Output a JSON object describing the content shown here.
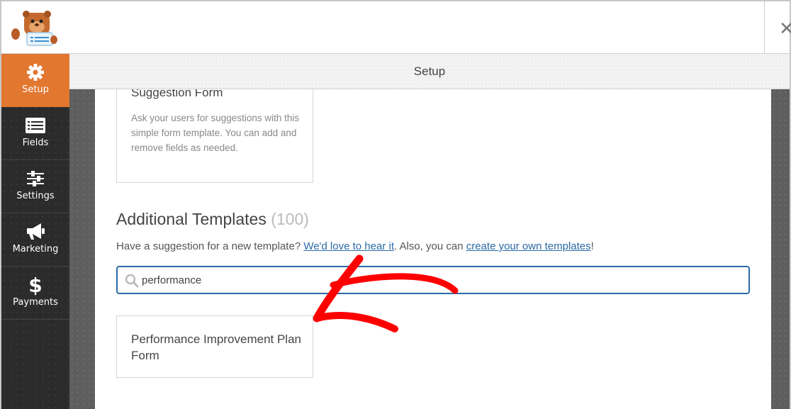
{
  "header": {
    "logo_alt": "WPForms bear mascot",
    "close_icon": "close-icon"
  },
  "sidebar": {
    "items": [
      {
        "label": "Setup",
        "icon": "gear-icon",
        "active": true
      },
      {
        "label": "Fields",
        "icon": "list-icon",
        "active": false
      },
      {
        "label": "Settings",
        "icon": "sliders-icon",
        "active": false
      },
      {
        "label": "Marketing",
        "icon": "megaphone-icon",
        "active": false
      },
      {
        "label": "Payments",
        "icon": "dollar-icon",
        "active": false
      }
    ]
  },
  "titlebar": {
    "title": "Setup"
  },
  "main": {
    "suggestion_card": {
      "title": "Suggestion Form",
      "description": "Ask your users for suggestions with this simple form template. You can add and remove fields as needed."
    },
    "additional": {
      "title": "Additional Templates",
      "count": "(100)",
      "desc_prefix": "Have a suggestion for a new template? ",
      "link1": "We'd love to hear it",
      "desc_middle": ". Also, you can ",
      "link2": "create your own templates",
      "desc_suffix": "!"
    },
    "search": {
      "value": "performance",
      "placeholder": ""
    },
    "results": [
      {
        "title": "Performance Improvement Plan Form"
      }
    ]
  },
  "colors": {
    "accent": "#e27730",
    "sidebar": "#2b2b2b",
    "link": "#2b6aa6",
    "annotation_arrow": "#ff0000"
  }
}
